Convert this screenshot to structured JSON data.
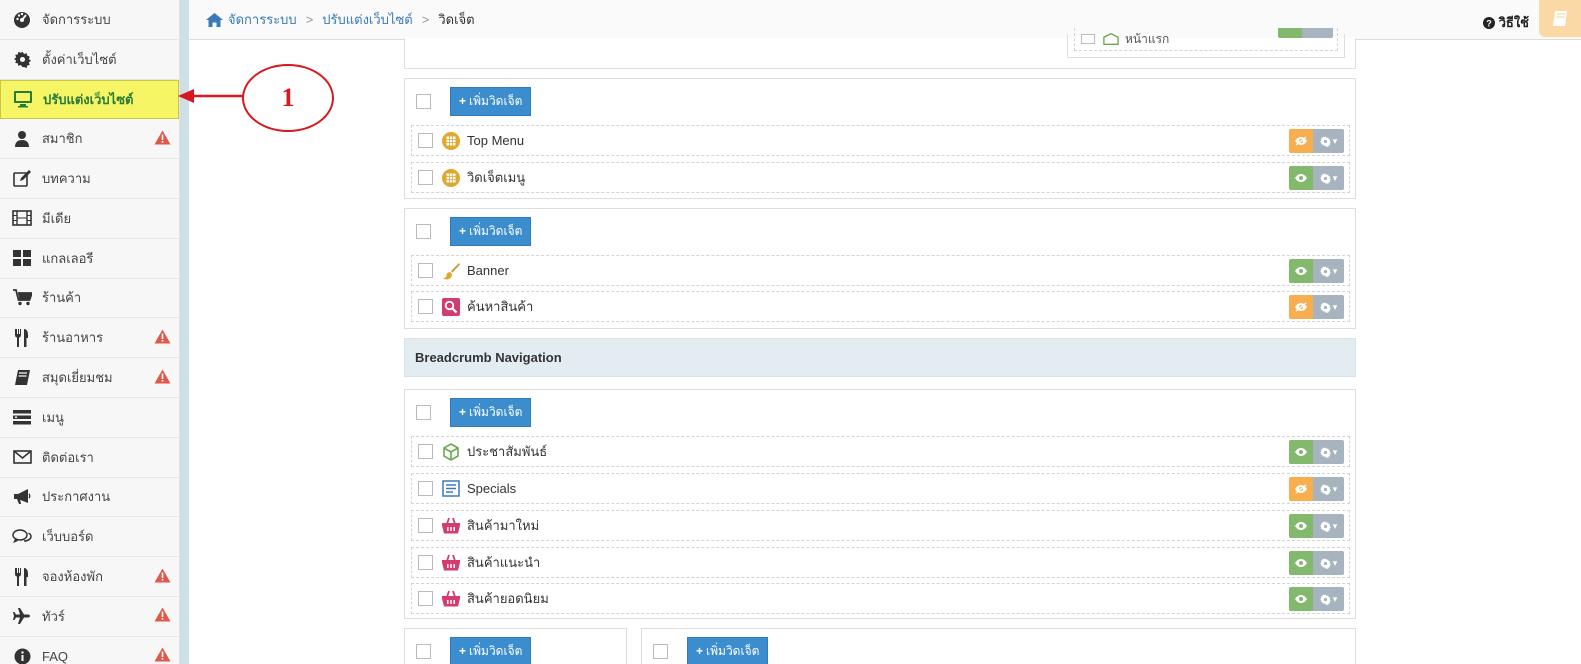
{
  "sidebar": {
    "items": [
      {
        "label": "จัดการระบบ",
        "icon": "dashboard-icon",
        "warn": false,
        "active": false
      },
      {
        "label": "ตั้งค่าเว็บไซต์",
        "icon": "gear-icon",
        "warn": false,
        "active": false
      },
      {
        "label": "ปรับแต่งเว็บไซต์",
        "icon": "monitor-icon",
        "warn": false,
        "active": true
      },
      {
        "label": "สมาชิก",
        "icon": "user-icon",
        "warn": true,
        "active": false
      },
      {
        "label": "บทความ",
        "icon": "edit-icon",
        "warn": false,
        "active": false
      },
      {
        "label": "มีเดีย",
        "icon": "film-icon",
        "warn": false,
        "active": false
      },
      {
        "label": "แกลเลอรี",
        "icon": "grid-icon",
        "warn": false,
        "active": false
      },
      {
        "label": "ร้านค้า",
        "icon": "cart-icon",
        "warn": false,
        "active": false
      },
      {
        "label": "ร้านอาหาร",
        "icon": "cutlery-icon",
        "warn": true,
        "active": false
      },
      {
        "label": "สมุดเยี่ยมชม",
        "icon": "book-icon",
        "warn": true,
        "active": false
      },
      {
        "label": "เมนู",
        "icon": "menu-list-icon",
        "warn": false,
        "active": false
      },
      {
        "label": "ติดต่อเรา",
        "icon": "envelope-icon",
        "warn": false,
        "active": false
      },
      {
        "label": "ประกาศงาน",
        "icon": "megaphone-icon",
        "warn": false,
        "active": false
      },
      {
        "label": "เว็บบอร์ด",
        "icon": "comments-icon",
        "warn": false,
        "active": false
      },
      {
        "label": "จองห้องพัก",
        "icon": "cutlery-icon",
        "warn": true,
        "active": false
      },
      {
        "label": "ทัวร์",
        "icon": "plane-icon",
        "warn": true,
        "active": false
      },
      {
        "label": "FAQ",
        "icon": "info-icon",
        "warn": true,
        "active": false
      }
    ]
  },
  "breadcrumb": {
    "home": "จัดการระบบ",
    "middle": "ปรับแต่งเว็บไซต์",
    "current": "วิดเจ็ต",
    "separator": ">"
  },
  "header": {
    "help_label": "วิธีใช้"
  },
  "add_widget_label": "เพิ่มวิดเจ็ต",
  "panels": {
    "top_cut_label": "หน้าแรก",
    "panel1": {
      "widgets": [
        {
          "label": "Top Menu",
          "icon": "grid-icon",
          "visibility": "orange"
        },
        {
          "label": "วิดเจ็ตเมนู",
          "icon": "grid-icon",
          "visibility": "green"
        }
      ]
    },
    "panel2": {
      "widgets": [
        {
          "label": "Banner",
          "icon": "paintbrush-icon",
          "visibility": "green"
        },
        {
          "label": "ค้นหาสินค้า",
          "icon": "search-icon",
          "visibility": "orange"
        }
      ]
    },
    "section_title": "Breadcrumb Navigation",
    "panel3": {
      "widgets": [
        {
          "label": "ประชาสัมพันธ์",
          "icon": "cube-icon",
          "visibility": "green"
        },
        {
          "label": "Specials",
          "icon": "list-icon",
          "visibility": "orange"
        },
        {
          "label": "สินค้ามาใหม่",
          "icon": "basket-icon",
          "visibility": "green"
        },
        {
          "label": "สินค้าแนะนำ",
          "icon": "basket-icon",
          "visibility": "green"
        },
        {
          "label": "สินค้ายอดนิยม",
          "icon": "basket-icon",
          "visibility": "green"
        }
      ]
    }
  },
  "annotation": {
    "number": "1"
  },
  "colors": {
    "accent": "#3c8dce",
    "active_bg": "#f5f566",
    "visible_green": "#82b96c",
    "hidden_orange": "#f8ad4e",
    "warning_red": "#e0584a",
    "annotation_red": "#d8171e"
  }
}
